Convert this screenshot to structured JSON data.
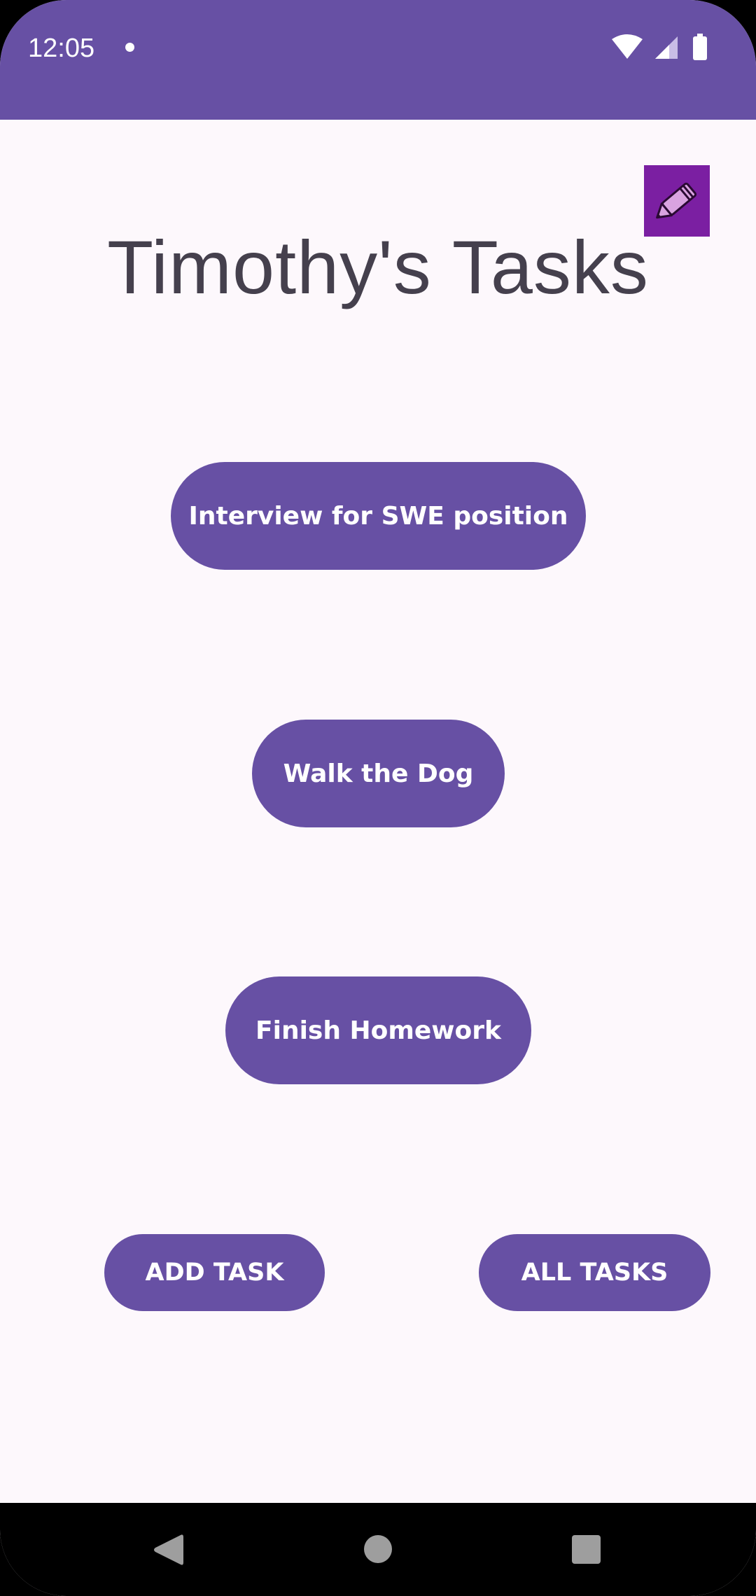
{
  "status_bar": {
    "time": "12:05",
    "icons": [
      "notification-dot-icon",
      "wifi-icon",
      "cellular-signal-icon",
      "battery-icon"
    ]
  },
  "header": {
    "title": "Timothy's Tasks",
    "edit_icon": "pencil-icon"
  },
  "tasks": [
    {
      "label": "Interview for SWE position"
    },
    {
      "label": "Walk the Dog"
    },
    {
      "label": "Finish Homework"
    }
  ],
  "actions": {
    "add_task": "ADD TASK",
    "all_tasks": "ALL TASKS"
  },
  "nav_bar": {
    "icons": [
      "back-icon",
      "home-icon",
      "recents-icon"
    ]
  },
  "colors": {
    "accent": "#6750a4",
    "edit_button": "#7b1fa2",
    "background": "#fdf8fc",
    "title_text": "#45404d"
  }
}
